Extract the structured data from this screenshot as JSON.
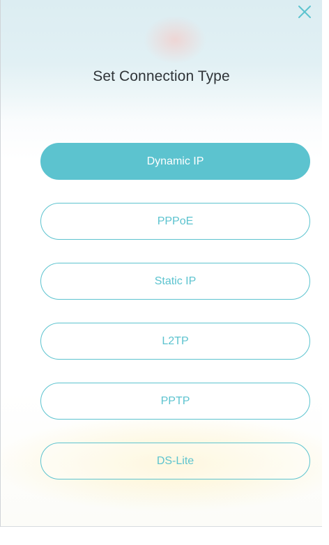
{
  "dialog": {
    "title": "Set Connection Type",
    "close_icon": "close-icon"
  },
  "options": [
    {
      "label": "Dynamic IP",
      "selected": true
    },
    {
      "label": "PPPoE",
      "selected": false
    },
    {
      "label": "Static IP",
      "selected": false
    },
    {
      "label": "L2TP",
      "selected": false
    },
    {
      "label": "PPTP",
      "selected": false
    },
    {
      "label": "DS-Lite",
      "selected": false
    }
  ],
  "colors": {
    "accent": "#5cc3cf",
    "title_text": "#2f3438",
    "close_icon": "#5cc3cf"
  }
}
